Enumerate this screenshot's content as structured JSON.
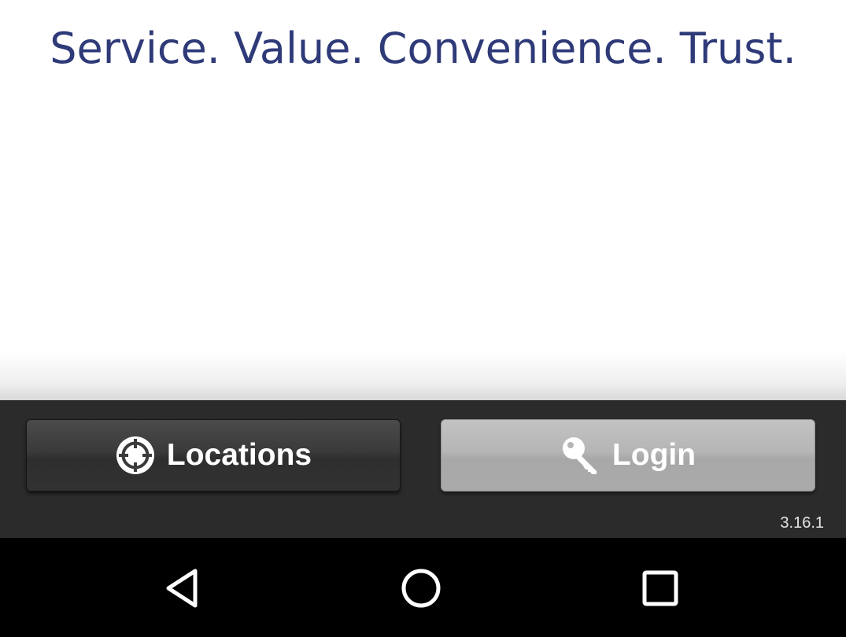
{
  "tagline": "Service. Value. Convenience. Trust.",
  "toolbar": {
    "locations_label": "Locations",
    "login_label": "Login",
    "locations_icon": "crosshair-icon",
    "login_icon": "key-icon"
  },
  "version": "3.16.1",
  "navbar": {
    "icons": [
      "back-icon",
      "home-icon",
      "recents-icon"
    ]
  },
  "colors": {
    "tagline": "#2f3a78",
    "toolbar_bg": "#2b2b2b",
    "locations_button": "#3a3a3a",
    "login_button": "#b5b5b5",
    "navbar_bg": "#000000"
  }
}
